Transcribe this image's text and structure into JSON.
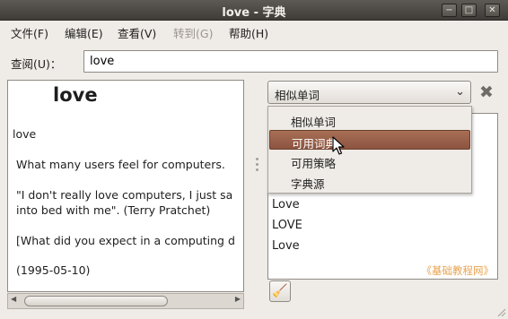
{
  "window": {
    "title": "love - 字典",
    "controls": {
      "minimize": "−",
      "maximize": "□",
      "close": "✕"
    }
  },
  "menu": [
    {
      "label": "文件(F)",
      "enabled": true
    },
    {
      "label": "编辑(E)",
      "enabled": true
    },
    {
      "label": "查看(V)",
      "enabled": true
    },
    {
      "label": "转到(G)",
      "enabled": false
    },
    {
      "label": "帮助(H)",
      "enabled": true
    }
  ],
  "search": {
    "label": "查阅(U)：",
    "value": "love"
  },
  "definition": {
    "headword": "love",
    "lines": [
      "love",
      "What many users feel for computers.",
      "\"I don't really love computers, I just sa",
      "into bed with me\". (Terry Pratchet)",
      "[What did you expect in a computing d",
      "(1995-05-10)"
    ]
  },
  "combo": {
    "selected": "相似单词",
    "arrow": "⌄"
  },
  "dropdown": {
    "options": [
      "相似单词",
      "可用词典",
      "可用策略",
      "字典源"
    ],
    "highlighted_index": 1
  },
  "results": {
    "items": [
      "Love",
      "LOVE",
      "Love"
    ],
    "watermark": "《基础教程网》"
  },
  "icons": {
    "clear": "✖",
    "broom": "🧹",
    "scroll_left": "◀",
    "scroll_right": "▶"
  }
}
